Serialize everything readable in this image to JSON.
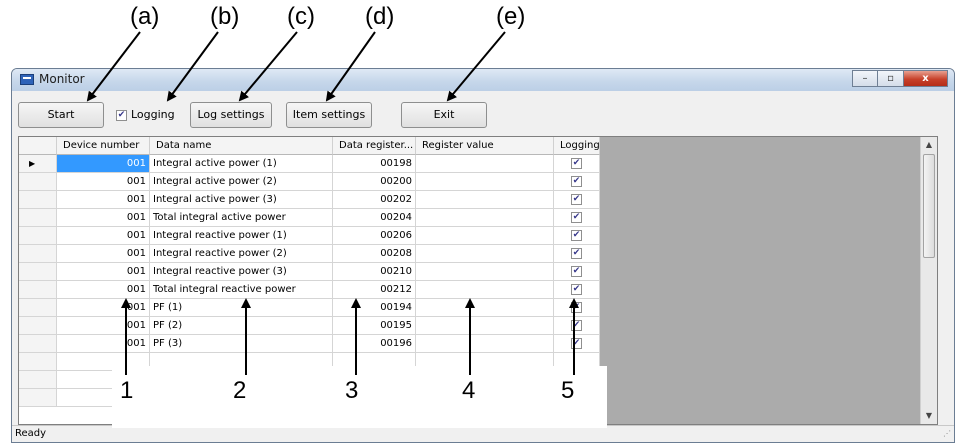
{
  "annotations": {
    "letters": [
      "(a)",
      "(b)",
      "(c)",
      "(d)",
      "(e)"
    ],
    "numbers": [
      "1",
      "2",
      "3",
      "4",
      "5"
    ]
  },
  "window": {
    "title": "Monitor",
    "controls": {
      "minimize": "–",
      "maximize": "▫",
      "close": "x"
    }
  },
  "toolbar": {
    "start_label": "Start",
    "logging_label": "Logging",
    "logging_checked": true,
    "log_settings_label": "Log settings",
    "item_settings_label": "Item settings",
    "exit_label": "Exit"
  },
  "table": {
    "columns": [
      "Device number",
      "Data name",
      "Data register...",
      "Register value",
      "Logging"
    ],
    "rows": [
      {
        "device": "001",
        "name": "Integral active power (1)",
        "register": "00198",
        "value": "",
        "logging": true
      },
      {
        "device": "001",
        "name": "Integral active power (2)",
        "register": "00200",
        "value": "",
        "logging": true
      },
      {
        "device": "001",
        "name": "Integral active power (3)",
        "register": "00202",
        "value": "",
        "logging": true
      },
      {
        "device": "001",
        "name": "Total integral active power",
        "register": "00204",
        "value": "",
        "logging": true
      },
      {
        "device": "001",
        "name": "Integral reactive power (1)",
        "register": "00206",
        "value": "",
        "logging": true
      },
      {
        "device": "001",
        "name": "Integral reactive power (2)",
        "register": "00208",
        "value": "",
        "logging": true
      },
      {
        "device": "001",
        "name": "Integral reactive power (3)",
        "register": "00210",
        "value": "",
        "logging": true
      },
      {
        "device": "001",
        "name": "Total integral reactive power",
        "register": "00212",
        "value": "",
        "logging": true
      },
      {
        "device": "001",
        "name": "PF (1)",
        "register": "00194",
        "value": "",
        "logging": true
      },
      {
        "device": "001",
        "name": "PF (2)",
        "register": "00195",
        "value": "",
        "logging": true
      },
      {
        "device": "001",
        "name": "PF (3)",
        "register": "00196",
        "value": "",
        "logging": true
      }
    ]
  },
  "status": {
    "text": "Ready"
  }
}
